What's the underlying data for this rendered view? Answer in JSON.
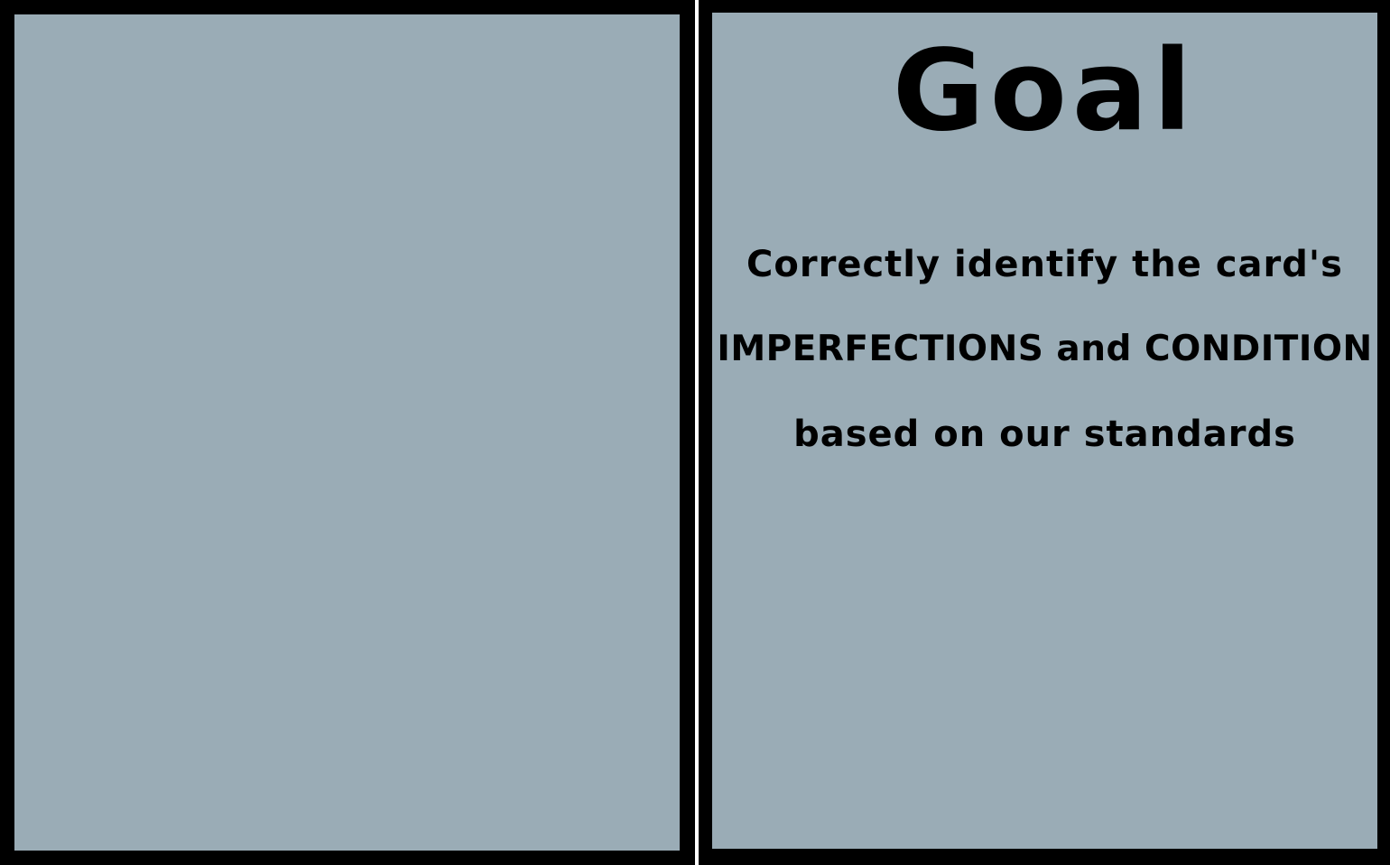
{
  "colors": {
    "panel_fill": "#9aacb6",
    "border": "#000000",
    "text": "#000000"
  },
  "left_panel": {
    "content": ""
  },
  "right_panel": {
    "title": "Goal",
    "lines": [
      "Correctly identify the card's",
      "IMPERFECTIONS and CONDITION",
      "based on our standards"
    ]
  }
}
